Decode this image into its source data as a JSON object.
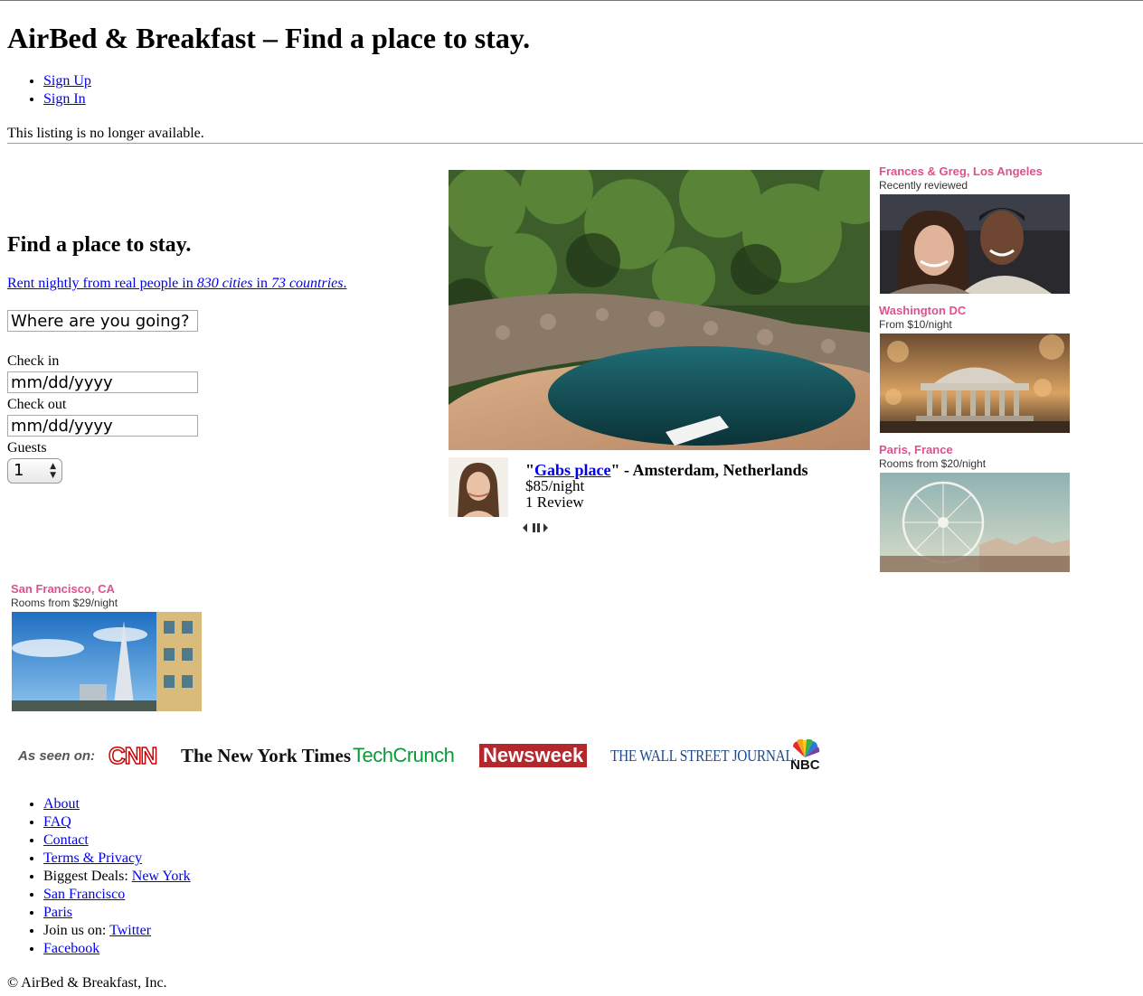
{
  "site": {
    "title": "AirBed & Breakfast – Find a place to stay.",
    "sign_up": "Sign Up",
    "sign_in": "Sign In",
    "notice": "This listing is no longer available."
  },
  "search": {
    "heading": "Find a place to stay.",
    "tagline_prefix": "Rent nightly from real people in ",
    "cities": "830 cities",
    "tagline_mid": " in ",
    "countries": "73 countries",
    "tagline_suffix": ".",
    "where_placeholder": "Where are you going?",
    "checkin_label": "Check in",
    "checkin_placeholder": "mm/dd/yyyy",
    "checkout_label": "Check out",
    "checkout_placeholder": "mm/dd/yyyy",
    "guests_label": "Guests",
    "guests_value": "1"
  },
  "featured": {
    "quote_open": "\"",
    "name": "Gabs place",
    "quote_close_location": "\" - Amsterdam, Netherlands",
    "price": "$85/night",
    "reviews": "1 Review"
  },
  "destinations": [
    {
      "title": "Frances & Greg, Los Angeles",
      "subtitle": "Recently reviewed"
    },
    {
      "title": "Washington DC",
      "subtitle": "From $10/night"
    },
    {
      "title": "Paris, France",
      "subtitle": "Rooms from $20/night"
    },
    {
      "title": "San Francisco, CA",
      "subtitle": "Rooms from $29/night"
    }
  ],
  "press": {
    "label": "As seen on:",
    "logos": [
      "CNN",
      "The New York Times",
      "TechCrunch",
      "Newsweek",
      "THE WALL STREET JOURNAL.",
      "NBC"
    ]
  },
  "footer": {
    "about": "About",
    "faq": "FAQ",
    "contact": "Contact",
    "terms": "Terms & Privacy",
    "deals_label": "Biggest Deals: ",
    "new_york": "New York",
    "san_francisco": "San Francisco",
    "paris": "Paris",
    "join_label": "Join us on: ",
    "twitter": "Twitter",
    "facebook": "Facebook",
    "copyright": "© AirBed & Breakfast, Inc."
  },
  "colors": {
    "link": "#0000ee",
    "destination_title": "#e0508c"
  }
}
